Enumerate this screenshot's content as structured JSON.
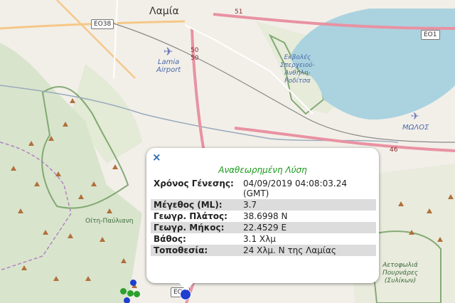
{
  "map": {
    "city_label": "Λαμία",
    "airport_label": "Lamia\nAirport",
    "estuary_label": "Εκβολές\nΣπερχειού-\nΑνθήλη-\nΡοδίτσα",
    "molos_label": "ΜΩΛΟΣ",
    "park_label": "Οίτη-Παύλιανη",
    "protected_label": "Αετοφωλιά\nΠουρνάρες\n(Συλίκων)",
    "road_shields": [
      "EO38",
      "EO1",
      "EO3"
    ],
    "road_numbers": [
      "51",
      "50",
      "50",
      "46"
    ]
  },
  "popup": {
    "close_label": "×",
    "title": "Αναθεωρημένη Λύση",
    "rows": [
      {
        "key": "Χρόνος Γένεσης:",
        "value": "04/09/2019 04:08:03.24 (GMT)"
      },
      {
        "key": "Μέγεθος (ML):",
        "value": "3.7"
      },
      {
        "key": "Γεωγρ. Πλάτος:",
        "value": "38.6998 N"
      },
      {
        "key": "Γεωγρ. Μήκος:",
        "value": "22.4529 E"
      },
      {
        "key": "Βάθος:",
        "value": "3.1 Χλμ"
      },
      {
        "key": "Τοποθεσία:",
        "value": "24 Χλμ. N της Λαμίας"
      }
    ]
  },
  "colors": {
    "water": "#aad3df",
    "motorway": "#e892a2",
    "green_marker": "#2ca02c",
    "blue_marker": "#1f3fd0"
  }
}
